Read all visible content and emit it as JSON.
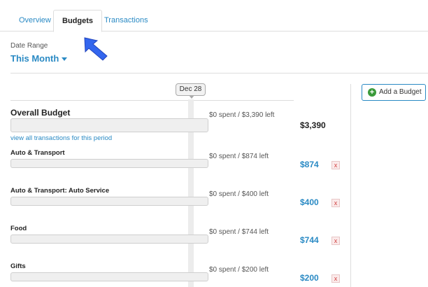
{
  "tabs": [
    {
      "label": "Overview",
      "active": false
    },
    {
      "label": "Budgets",
      "active": true
    },
    {
      "label": "Transactions",
      "active": false
    }
  ],
  "date_range": {
    "label": "Date Range",
    "value": "This Month"
  },
  "timeline": {
    "marker": "Dec 28"
  },
  "overall": {
    "name": "Overall Budget",
    "spent_text": "$0 spent / $3,390 left",
    "amount": "$3,390",
    "view_all_link": "view all transactions for this period"
  },
  "budgets": [
    {
      "name": "Auto & Transport",
      "spent_text": "$0 spent / $874 left",
      "amount": "$874"
    },
    {
      "name": "Auto & Transport: Auto Service",
      "spent_text": "$0 spent / $400 left",
      "amount": "$400"
    },
    {
      "name": "Food",
      "spent_text": "$0 spent / $744 left",
      "amount": "$744"
    },
    {
      "name": "Gifts",
      "spent_text": "$0 spent / $200 left",
      "amount": "$200"
    }
  ],
  "add_budget_button": {
    "label": "Add a Budget",
    "icon": "plus-circle-icon"
  },
  "delete_glyph": "x",
  "colors": {
    "link": "#2a8ac4",
    "add_icon": "#3a9a3a",
    "delete": "#d04040",
    "pointer_arrow": "#3366ee"
  }
}
